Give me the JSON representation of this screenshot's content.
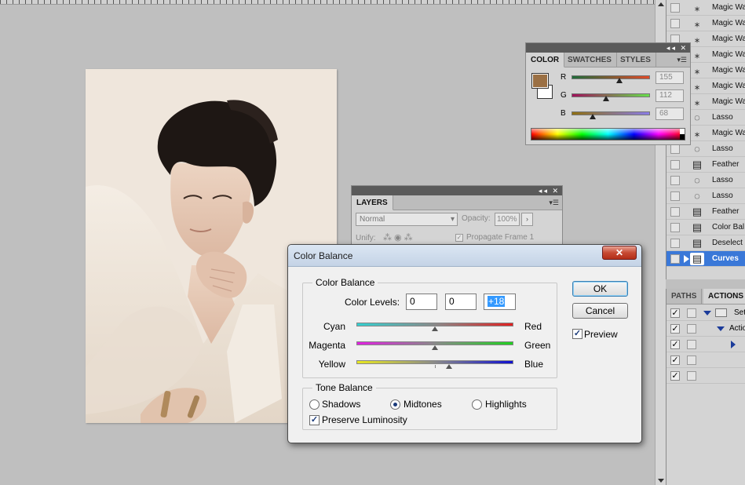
{
  "history": {
    "items": [
      {
        "label": "Magic Wa",
        "icon": "magic-wand-icon"
      },
      {
        "label": "Magic Wa",
        "icon": "magic-wand-icon"
      },
      {
        "label": "Magic Wa",
        "icon": "magic-wand-icon"
      },
      {
        "label": "Magic Wa",
        "icon": "magic-wand-icon"
      },
      {
        "label": "Magic Wa",
        "icon": "magic-wand-icon"
      },
      {
        "label": "Magic Wa",
        "icon": "magic-wand-icon"
      },
      {
        "label": "Magic Wa",
        "icon": "magic-wand-icon"
      },
      {
        "label": "Lasso",
        "icon": "lasso-icon"
      },
      {
        "label": "Magic Wa",
        "icon": "magic-wand-icon"
      },
      {
        "label": "Lasso",
        "icon": "lasso-icon"
      },
      {
        "label": "Feather",
        "icon": "history-state-icon"
      },
      {
        "label": "Lasso",
        "icon": "lasso-icon"
      },
      {
        "label": "Lasso",
        "icon": "lasso-icon"
      },
      {
        "label": "Feather",
        "icon": "history-state-icon"
      },
      {
        "label": "Color Bal",
        "icon": "history-state-icon"
      },
      {
        "label": "Deselect",
        "icon": "history-state-icon"
      },
      {
        "label": "Curves",
        "icon": "history-state-icon"
      }
    ],
    "selected_label": "Curves"
  },
  "actions_panel": {
    "tabs": [
      "PATHS",
      "ACTIONS"
    ],
    "active_tab": "ACTIONS",
    "rows": [
      {
        "label": "Set",
        "checked": true
      },
      {
        "label": "Actio",
        "checked": true
      },
      {
        "label": "",
        "checked": true
      },
      {
        "label": "",
        "checked": true
      },
      {
        "label": "",
        "checked": true
      }
    ]
  },
  "color_panel": {
    "tabs": [
      "COLOR",
      "SWATCHES",
      "STYLES"
    ],
    "active_tab": "COLOR",
    "foreground": "#9b7044",
    "background": "#ffffff",
    "channels": [
      {
        "letter": "R",
        "value": "155",
        "fraction": 0.61,
        "gradient": [
          "#1f6b3a",
          "#e04a28"
        ]
      },
      {
        "letter": "G",
        "value": "112",
        "fraction": 0.44,
        "gradient": [
          "#a0105a",
          "#66e04a"
        ]
      },
      {
        "letter": "B",
        "value": "68",
        "fraction": 0.27,
        "gradient": [
          "#8f6f10",
          "#8a7ce8"
        ]
      }
    ]
  },
  "layers_panel": {
    "tab": "LAYERS",
    "blend_mode": "Normal",
    "opacity_label": "Opacity:",
    "opacity_value": "100%",
    "unify_label": "Unify:",
    "propagate_label": "Propagate Frame 1"
  },
  "dialog": {
    "title": "Color Balance",
    "close_glyph": "✕",
    "color_balance_group": "Color Balance",
    "color_levels_label": "Color Levels:",
    "levels": [
      "0",
      "0",
      "+18"
    ],
    "sliders": [
      {
        "left": "Cyan",
        "right": "Red",
        "fraction": 0.5,
        "gradient": [
          "#33d0d0",
          "#e02020"
        ]
      },
      {
        "left": "Magenta",
        "right": "Green",
        "fraction": 0.5,
        "gradient": [
          "#e020e0",
          "#20d020"
        ]
      },
      {
        "left": "Yellow",
        "right": "Blue",
        "fraction": 0.59,
        "gradient": [
          "#e8e820",
          "#1010d0"
        ]
      }
    ],
    "tone_balance_group": "Tone Balance",
    "tones": [
      {
        "label": "Shadows",
        "selected": false
      },
      {
        "label": "Midtones",
        "selected": true
      },
      {
        "label": "Highlights",
        "selected": false
      }
    ],
    "preserve_luminosity_label": "Preserve Luminosity",
    "preserve_luminosity_checked": true,
    "ok_label": "OK",
    "cancel_label": "Cancel",
    "preview_label": "Preview",
    "preview_checked": true
  }
}
